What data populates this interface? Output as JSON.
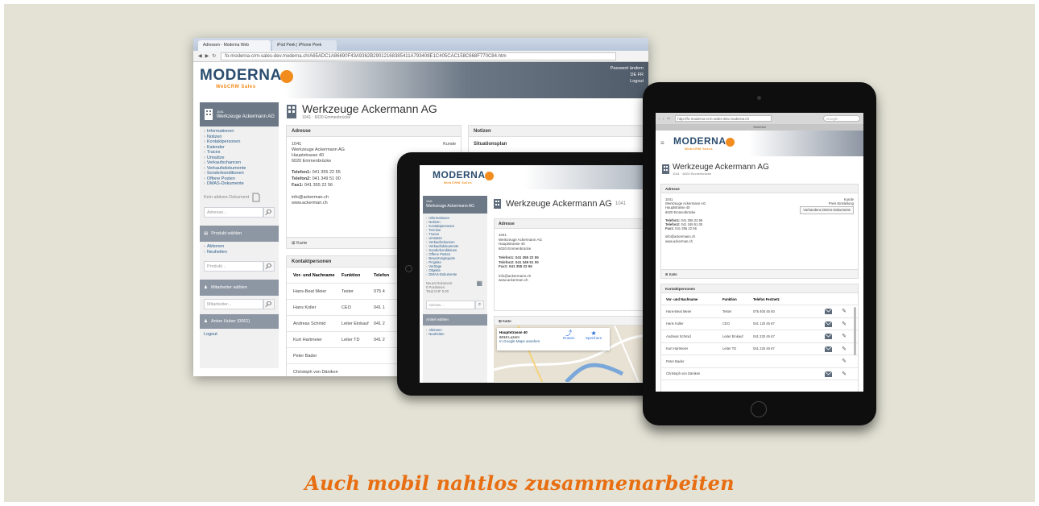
{
  "colors": {
    "background": "#e3e2d5",
    "brand_blue": "#2b4d6f",
    "brand_orange": "#f28c1c",
    "caption_orange": "#e86e12"
  },
  "caption": "Auch mobil nahtlos zusammenarbeiten",
  "brand": {
    "name": "MODERNA",
    "sub": "WebCRM Sales"
  },
  "desktop": {
    "tabs": [
      "Adressen - Moderna Web",
      "iPod Peek | iPhone Peek"
    ],
    "url": "fo-moderna-crm-sales-dev.moderna.ch/A65ADC1A86690F43A9362B29012168385411A793408E1C405CAC158C668F770C84.htm",
    "header_right": [
      "Passwort ändern",
      "DE FR",
      "Logout"
    ],
    "company_number": "1041",
    "company_name": "Werkzeuge Ackermann AG",
    "sidebar_items": [
      "Informationen",
      "Notizen",
      "Kontaktpersonen",
      "Kalender",
      "Traces",
      "Umsätze",
      "Verkaufschancen",
      "Verkaufsdokumente",
      "Sonderkonditionen",
      "Offene Posten",
      "DMAS-Dokumente"
    ],
    "no_document": "Kein aktives Dokument",
    "address_search_placeholder": "Adresse...",
    "product_panel": "Produkt wählen",
    "product_items": [
      "Aktionen",
      "Neuheiten"
    ],
    "product_placeholder": "Produkt...",
    "employee_panel": "Mitarbeiter wählen",
    "employee_placeholder": "Mitarbeiter...",
    "user_panel": "Anton Huber (0061)",
    "logout": "Logout",
    "subtitle": "1041 · 6020 Emmenbrücke",
    "address_head": "Adresse",
    "notes_head": "Notizen",
    "address_lines": [
      "1041",
      "Werkzeuge Ackermann AG",
      "Hauptstrasse 40",
      "6020 Emmenbrücke"
    ],
    "phones": [
      {
        "label": "Telefon1:",
        "value": "041 355 22 55"
      },
      {
        "label": "Telefon2:",
        "value": "041 349 51 00"
      },
      {
        "label": "Fax1:",
        "value": "041 355 22 56"
      }
    ],
    "email": "info@ackerman.ch",
    "web": "www.ackerman.ch",
    "customer_label": "Kunde",
    "notes_title": "Situationsplan",
    "map_head": "Karte",
    "contacts_head": "Kontaktpersonen",
    "contacts_columns": [
      "Vor- und Nachname",
      "Funktion",
      "Telefon"
    ],
    "contacts": [
      {
        "name": "Hans-Beat Meier",
        "role": "Tester",
        "phone": "075 4"
      },
      {
        "name": "Hans Koller",
        "role": "CEO",
        "phone": "041 1"
      },
      {
        "name": "Andreas Schmid",
        "role": "Leiter Einkauf",
        "phone": "041 2"
      },
      {
        "name": "Kurt Hartmeier",
        "role": "Leiter TD",
        "phone": "041 2"
      },
      {
        "name": "Peter Bader",
        "role": "",
        "phone": ""
      },
      {
        "name": "Christoph von Dänikon",
        "role": "",
        "phone": ""
      }
    ]
  },
  "tablet_landscape": {
    "company_name": "Werkzeuge Ackermann AG",
    "company_number": "1041",
    "sidebar_items": [
      "Informationen",
      "Notizen",
      "Kontaktpersonen",
      "Termine",
      "Traces",
      "Umsätze",
      "Verkaufschancen",
      "Verkaufsdokumente",
      "Sonderkonditionen",
      "Offene Posten",
      "Bewertungsquote",
      "Projekte",
      "Verträge",
      "Objekte",
      "DMAS-Dokumente"
    ],
    "new_document": "Neues Dokument",
    "doc_detail": [
      "0 Positionen",
      "Total CHF 0.00"
    ],
    "address_placeholder": "Adresse...",
    "product_panel": "Artikel wählen",
    "product_items": [
      "Aktionen",
      "Neuheiten"
    ],
    "address_head": "Adresse",
    "address_lines": [
      "1041",
      "Werkzeuge Ackermann AG",
      "Hauptstrasse 40",
      "6020 Emmenbrücke"
    ],
    "phones": [
      "Telefon1: 041 355 22 55",
      "Telefon2: 041 349 51 00",
      "Fax1: 041 355 22 56"
    ],
    "email": "info@ackermann.ch",
    "web": "www.ackerman.ch",
    "map_head": "Karte",
    "map_card_title": "Hauptstrasse 40",
    "map_card_city": "6018 Luzern",
    "map_card_link": "In Google Maps ansehen",
    "map_route": "Routen",
    "map_save": "Speichern"
  },
  "tablet_portrait": {
    "url": "http://fo-moderna-crm-sales-dev.moderna.ch",
    "search_placeholder": "Google",
    "page_title": "WebMail",
    "company_name": "Werkzeuge Ackermann AG",
    "subtitle": "1041 · 6020 Emmenbrücke",
    "address_head": "Adresse",
    "address_lines": [
      "1041",
      "Werkzeuge Ackermann AG",
      "Hauptstrasse 40",
      "6020 Emmenbrücke"
    ],
    "customer_label": "Kunde",
    "price_label": "Preis Einstellung",
    "dmas_button": "Vorhandene DMAS-Dokumente",
    "phones": [
      {
        "label": "Telefon1:",
        "value": "041 355 22 56"
      },
      {
        "label": "Telefon2:",
        "value": "041 349 51 00"
      },
      {
        "label": "Fax1:",
        "value": "041 355 22 56"
      }
    ],
    "email": "info@ackermann.ch",
    "web": "www.ackerman.ch",
    "map_head": "Karte",
    "contacts_head": "Kontaktpersonen",
    "contacts_columns": [
      "Vor- und Nachname",
      "Funktion",
      "Telefon Festnetz"
    ],
    "contacts": [
      {
        "name": "Hans-Beat Meier",
        "role": "Tester",
        "phone": "075 400 45 50",
        "mail": true
      },
      {
        "name": "Hans Koller",
        "role": "CEO",
        "phone": "041 120 45 67",
        "mail": true
      },
      {
        "name": "Andreas Schmid",
        "role": "Leiter Einkauf",
        "phone": "041 220 45 67",
        "mail": true
      },
      {
        "name": "Kurt Hartmeier",
        "role": "Leiter TD",
        "phone": "041 220 45 67",
        "mail": true
      },
      {
        "name": "Peter Bader",
        "role": "",
        "phone": "",
        "mail": false
      },
      {
        "name": "Christoph von Däniken",
        "role": "",
        "phone": "",
        "mail": true
      }
    ]
  }
}
